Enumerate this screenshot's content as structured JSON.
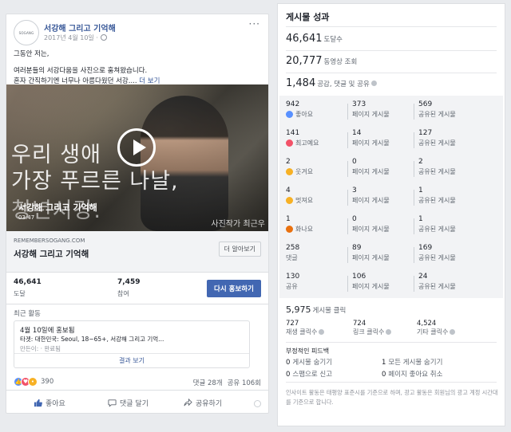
{
  "post": {
    "page_name": "서강해 그리고 기억해",
    "avatar_text": "SOGANG",
    "date": "2017년 4월 10일 ·",
    "more": "···",
    "text_line1": "그동안 저는,",
    "text_line2": "여러분들의 서강다움을 사진으로 훔쳐왔습니다.",
    "text_line3": "혼자 간직하기엔 너무나 아름다웠던 서강.... ",
    "see_more": "더 보기",
    "video": {
      "overlay_line1": "우리 생애",
      "overlay_line2": "가장 푸르른 나날,",
      "overlay_line3": "청년서강.",
      "title": "서강해 그리고 기억해",
      "duration": "03:47",
      "credit": "사진작가 최근우"
    },
    "link": {
      "domain": "REMEMBERSOGANG.COM",
      "title": "서강해 그리고 기억해",
      "button": "더 알아보기"
    },
    "stats": {
      "reach_value": "46,641",
      "reach_label": "도달",
      "engagement_value": "7,459",
      "engagement_label": "참여",
      "boost_button": "다시 홍보하기"
    },
    "recent": {
      "header": "최근 활동",
      "title": "4월 10일에 홍보됨",
      "target": "타겟: 대한민국: Seoul, 18~65+, 서강해 그리고 기억...",
      "creator": "만든이:   · 완료됨",
      "view": "결과 보기"
    },
    "reactions": {
      "count": "390",
      "comments": "댓글 28개",
      "shares": "공유 106회"
    },
    "actions": {
      "like": "좋아요",
      "comment": "댓글 달기",
      "share": "공유하기"
    }
  },
  "panel": {
    "title": "게시물 성과",
    "reach": {
      "value": "46,641",
      "label": "도달수"
    },
    "video_views": {
      "value": "20,777",
      "label": "동영상 조회"
    },
    "engagement": {
      "value": "1,484",
      "label": "공감, 댓글 및 공유"
    },
    "grid": [
      {
        "total": {
          "value": "942",
          "label": "좋아요",
          "icon": "like-icon"
        },
        "page": {
          "value": "373",
          "label": "페이지 게시물"
        },
        "shared": {
          "value": "569",
          "label": "공유된 게시물"
        }
      },
      {
        "total": {
          "value": "141",
          "label": "최고예요",
          "icon": "love-icon"
        },
        "page": {
          "value": "14",
          "label": "페이지 게시물"
        },
        "shared": {
          "value": "127",
          "label": "공유된 게시물"
        }
      },
      {
        "total": {
          "value": "2",
          "label": "웃겨요",
          "icon": "haha-icon"
        },
        "page": {
          "value": "0",
          "label": "페이지 게시물"
        },
        "shared": {
          "value": "2",
          "label": "공유된 게시물"
        }
      },
      {
        "total": {
          "value": "4",
          "label": "멋져요",
          "icon": "wow-icon"
        },
        "page": {
          "value": "3",
          "label": "페이지 게시물"
        },
        "shared": {
          "value": "1",
          "label": "공유된 게시물"
        }
      },
      {
        "total": {
          "value": "1",
          "label": "화나요",
          "icon": "angry-icon"
        },
        "page": {
          "value": "0",
          "label": "페이지 게시물"
        },
        "shared": {
          "value": "1",
          "label": "공유된 게시물"
        }
      },
      {
        "total": {
          "value": "258",
          "label": "댓글"
        },
        "page": {
          "value": "89",
          "label": "페이지 게시물"
        },
        "shared": {
          "value": "169",
          "label": "공유된 게시물"
        }
      },
      {
        "total": {
          "value": "130",
          "label": "공유"
        },
        "page": {
          "value": "106",
          "label": "페이지 게시물"
        },
        "shared": {
          "value": "24",
          "label": "공유된 게시물"
        }
      }
    ],
    "clicks": {
      "value": "5,975",
      "label": "게시물 클릭",
      "play": {
        "value": "727",
        "label": "재생 클릭수"
      },
      "link": {
        "value": "724",
        "label": "링크 클릭수"
      },
      "other": {
        "value": "4,524",
        "label": "기타 클릭수"
      }
    },
    "negative": {
      "header": "부정적인 피드백",
      "hide_post": {
        "value": "0",
        "label": "게시물 숨기기"
      },
      "hide_all": {
        "value": "1",
        "label": "모든 게시물 숨기기"
      },
      "spam": {
        "value": "0",
        "label": "스팸으로 신고"
      },
      "unlike": {
        "value": "0",
        "label": "페이지 좋아요 취소"
      }
    },
    "footnote": "인사이트 활동은 태평양 표준시를 기준으로 하며, 광고 활동은 회원님의 광고 계정 시간대를 기준으로 합니다."
  },
  "colors": {
    "brand": "#4267b2",
    "link": "#385898",
    "background": "#e9ebee"
  }
}
